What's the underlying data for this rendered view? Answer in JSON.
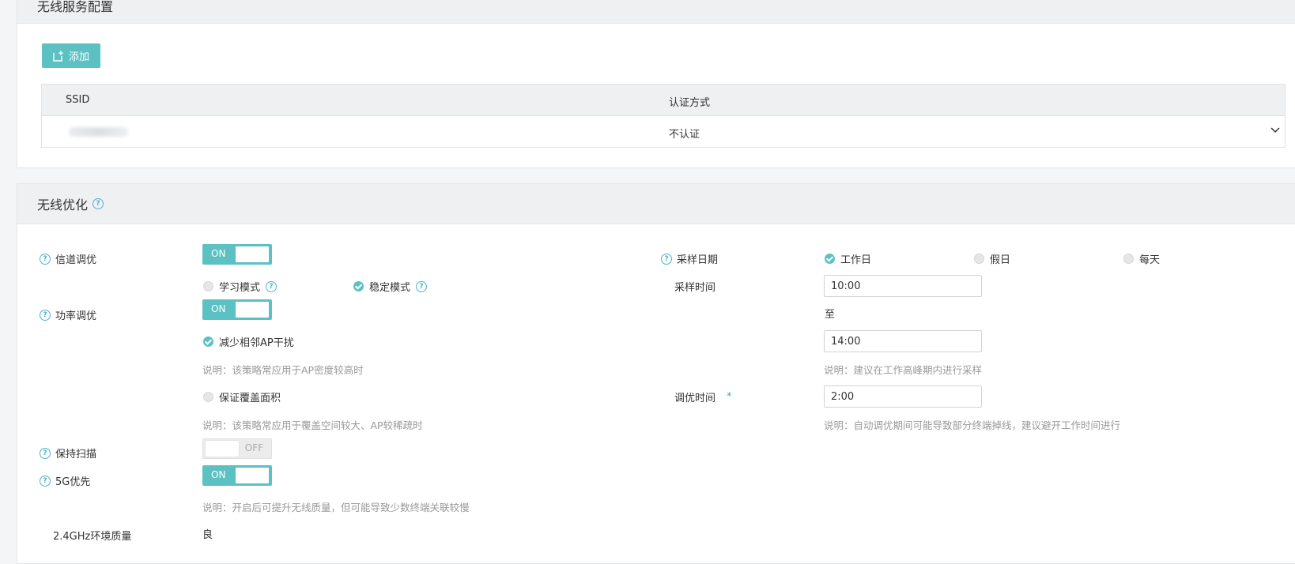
{
  "service_section": {
    "title": "无线服务配置",
    "add_label": "添加",
    "table": {
      "headers": [
        "SSID",
        "认证方式"
      ],
      "rows": [
        {
          "ssid": "",
          "auth": "不认证"
        }
      ]
    }
  },
  "optimization": {
    "title": "无线优化",
    "channel_tuning": {
      "label": "信道调优",
      "state": "ON",
      "modes": [
        {
          "label": "学习模式",
          "selected": false
        },
        {
          "label": "稳定模式",
          "selected": true
        }
      ]
    },
    "power_tuning": {
      "label": "功率调优",
      "state": "ON",
      "options": [
        {
          "label": "减少相邻AP干扰",
          "selected": true,
          "note": "说明：该策略常应用于AP密度较高时"
        },
        {
          "label": "保证覆盖面积",
          "selected": false,
          "note": "说明：该策略常应用于覆盖空间较大、AP较稀疏时"
        }
      ]
    },
    "keep_scan": {
      "label": "保持扫描",
      "state": "OFF"
    },
    "5g_priority": {
      "label": "5G优先",
      "state": "ON",
      "note": "说明：开启后可提升无线质量，但可能导致少数终端关联较慢"
    },
    "env_quality": {
      "label": "2.4GHz环境质量",
      "value": "良"
    },
    "sampling_date": {
      "label": "采样日期",
      "options": [
        {
          "label": "工作日",
          "selected": true
        },
        {
          "label": "假日",
          "selected": false
        },
        {
          "label": "每天",
          "selected": false
        }
      ]
    },
    "sampling_time": {
      "label": "采样时间",
      "start": "10:00",
      "to": "至",
      "end": "14:00",
      "note": "说明：建议在工作高峰期内进行采样"
    },
    "tuning_time": {
      "label": "调优时间",
      "required_mark": "*",
      "value": "2:00",
      "note": "说明：自动调优期间可能导致部分终端掉线，建议避开工作时间进行"
    }
  },
  "colors": {
    "accent": "#5cc1c3",
    "help_icon": "#4db3c8",
    "header_bg": "#eef0f2"
  },
  "icons": {
    "add": "add-icon",
    "expand": "chevron-down-icon",
    "help": "question-circle-icon"
  }
}
